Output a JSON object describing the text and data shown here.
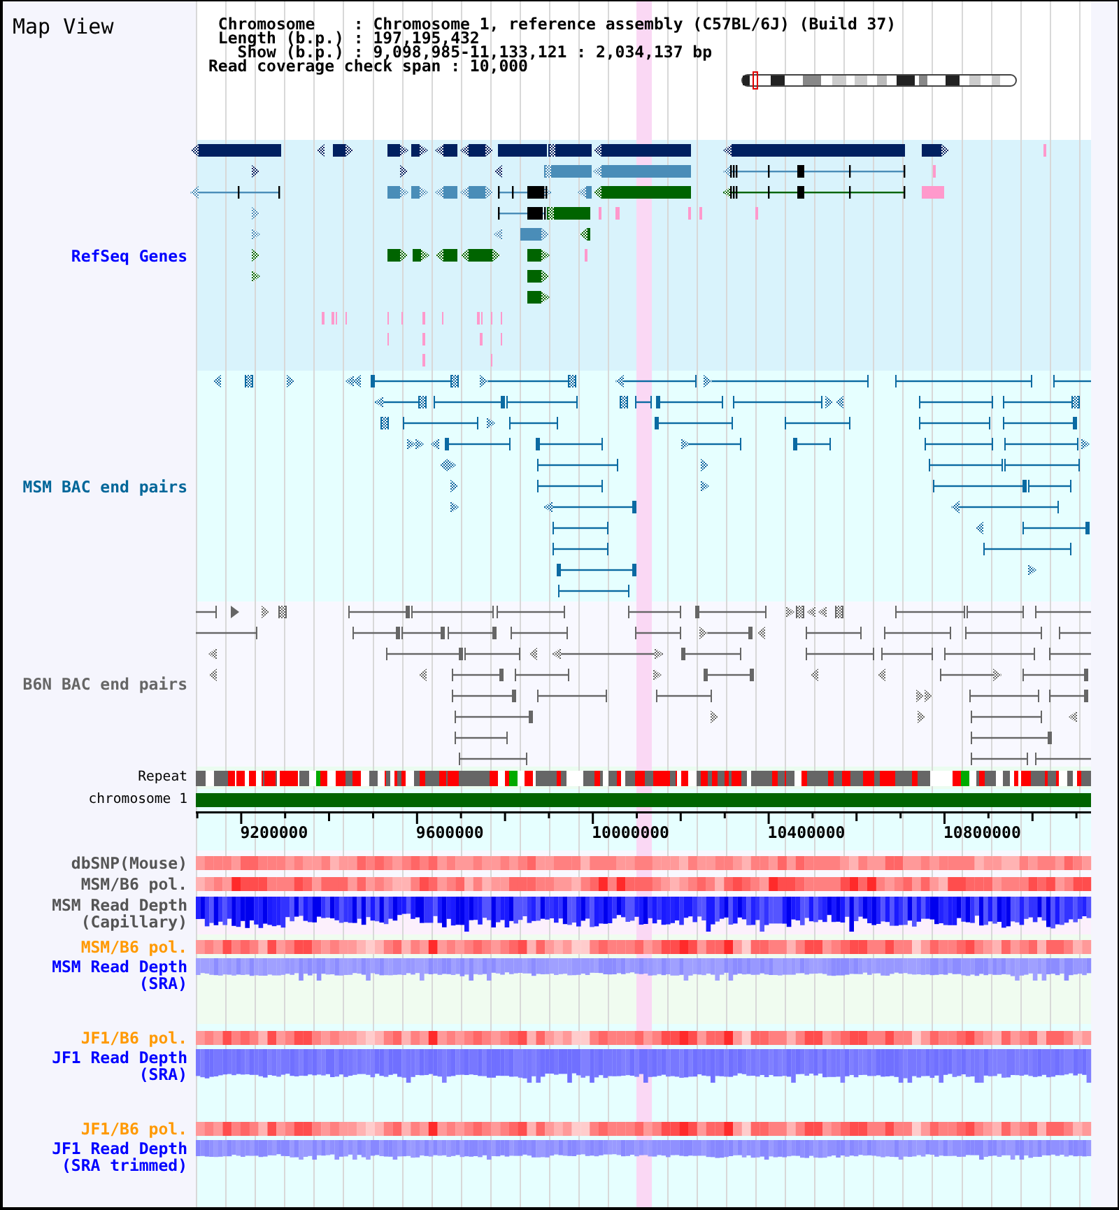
{
  "title": "Map View",
  "info": [
    "Chromosome    : Chromosome 1, reference assembly (C57BL/6J) (Build 37)",
    "Length (b.p.) : 197,195,432",
    "Show (b.p.) : 9,098,985-11,133,121 : 2,034,137 bp",
    "Read coverage check span : 10,000"
  ],
  "tracks": [
    {
      "kind": "genes",
      "label": "RefSeq Genes",
      "color": "#0000ff"
    },
    {
      "kind": "pairs",
      "label": "MSM BAC end pairs",
      "color": "#006699"
    },
    {
      "kind": "pairs",
      "label": "B6N BAC end pairs",
      "color": "#666666"
    },
    {
      "kind": "repeat",
      "label": "Repeat",
      "color": "#000000"
    },
    {
      "kind": "chromosome",
      "label": "chromosome 1",
      "color": "#000000"
    },
    {
      "kind": "axis",
      "ticks": [
        "9200000",
        "9600000",
        "10000000",
        "10400000",
        "10800000"
      ]
    },
    {
      "kind": "polymorphism",
      "label": "dbSNP(Mouse)",
      "color": "#555555"
    },
    {
      "kind": "polymorphism",
      "label": "MSM/B6 pol.",
      "color": "#555555"
    },
    {
      "kind": "depth",
      "label": "MSM Read Depth (Capillary)",
      "color": "#555555"
    },
    {
      "kind": "polymorphism",
      "label": "MSM/B6 pol.",
      "color": "#ff9900"
    },
    {
      "kind": "depth",
      "label": "MSM Read Depth (SRA)",
      "color": "#0000ff"
    },
    {
      "kind": "polymorphism",
      "label": "JF1/B6 pol.",
      "color": "#ff9900"
    },
    {
      "kind": "depth",
      "label": "JF1 Read Depth (SRA)",
      "color": "#0000ff"
    },
    {
      "kind": "polymorphism",
      "label": "JF1/B6 pol.",
      "color": "#ff9900"
    },
    {
      "kind": "depth",
      "label": "JF1 Read Depth (SRA trimmed)",
      "color": "#0000ff"
    }
  ]
}
